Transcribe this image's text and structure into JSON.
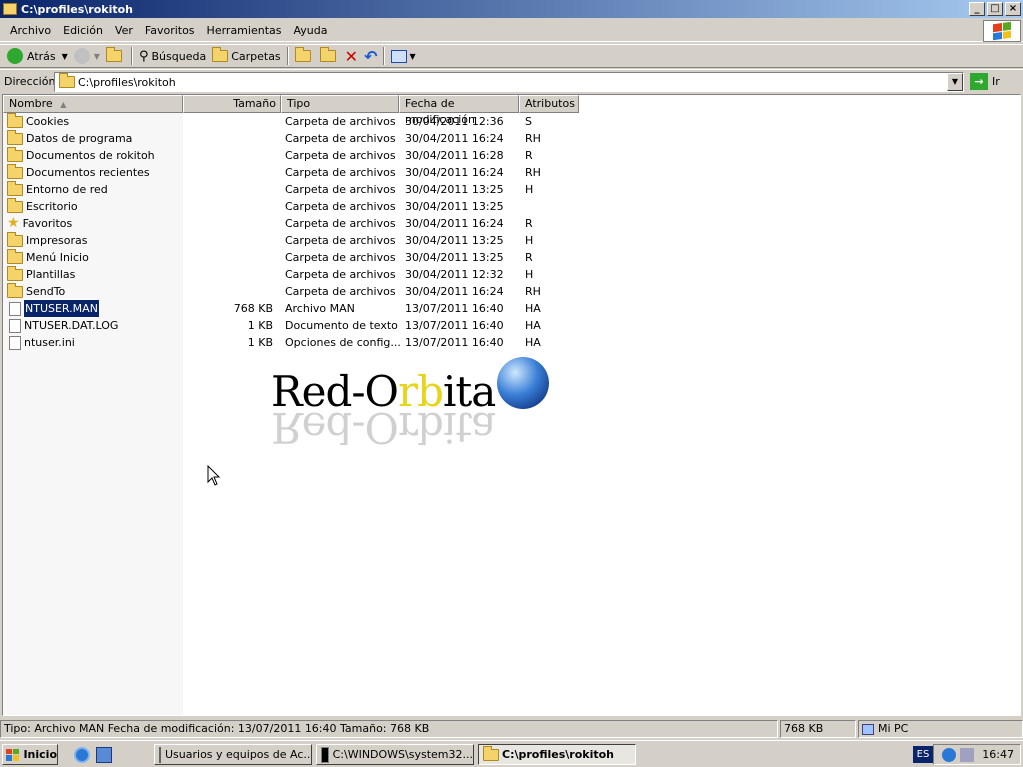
{
  "window": {
    "title": "C:\\profiles\\rokitoh"
  },
  "menu": [
    "Archivo",
    "Edición",
    "Ver",
    "Favoritos",
    "Herramientas",
    "Ayuda"
  ],
  "toolbar": {
    "back": "Atrás",
    "search": "Búsqueda",
    "folders": "Carpetas"
  },
  "address": {
    "label": "Dirección",
    "value": "C:\\profiles\\rokitoh",
    "go": "Ir"
  },
  "columns": {
    "name": "Nombre",
    "size": "Tamaño",
    "type": "Tipo",
    "modified": "Fecha de modificación",
    "attributes": "Atributos"
  },
  "files": [
    {
      "name": "Cookies",
      "size": "",
      "type": "Carpeta de archivos",
      "date": "30/04/2011 12:36",
      "attr": "S",
      "icon": "folder-icon"
    },
    {
      "name": "Datos de programa",
      "size": "",
      "type": "Carpeta de archivos",
      "date": "30/04/2011 16:24",
      "attr": "RH",
      "icon": "folder-icon"
    },
    {
      "name": "Documentos de rokitoh",
      "size": "",
      "type": "Carpeta de archivos",
      "date": "30/04/2011 16:28",
      "attr": "R",
      "icon": "folder-icon"
    },
    {
      "name": "Documentos recientes",
      "size": "",
      "type": "Carpeta de archivos",
      "date": "30/04/2011 16:24",
      "attr": "RH",
      "icon": "recent-folder-icon"
    },
    {
      "name": "Entorno de red",
      "size": "",
      "type": "Carpeta de archivos",
      "date": "30/04/2011 13:25",
      "attr": "H",
      "icon": "folder-icon"
    },
    {
      "name": "Escritorio",
      "size": "",
      "type": "Carpeta de archivos",
      "date": "30/04/2011 13:25",
      "attr": "",
      "icon": "folder-icon"
    },
    {
      "name": "Favoritos",
      "size": "",
      "type": "Carpeta de archivos",
      "date": "30/04/2011 16:24",
      "attr": "R",
      "icon": "star-icon"
    },
    {
      "name": "Impresoras",
      "size": "",
      "type": "Carpeta de archivos",
      "date": "30/04/2011 13:25",
      "attr": "H",
      "icon": "folder-icon"
    },
    {
      "name": "Menú Inicio",
      "size": "",
      "type": "Carpeta de archivos",
      "date": "30/04/2011 13:25",
      "attr": "R",
      "icon": "folder-icon"
    },
    {
      "name": "Plantillas",
      "size": "",
      "type": "Carpeta de archivos",
      "date": "30/04/2011 12:32",
      "attr": "H",
      "icon": "folder-icon"
    },
    {
      "name": "SendTo",
      "size": "",
      "type": "Carpeta de archivos",
      "date": "30/04/2011 16:24",
      "attr": "RH",
      "icon": "folder-icon"
    },
    {
      "name": "NTUSER.MAN",
      "size": "768 KB",
      "type": "Archivo MAN",
      "date": "13/07/2011 16:40",
      "attr": "HA",
      "icon": "file-icon",
      "selected": true
    },
    {
      "name": "NTUSER.DAT.LOG",
      "size": "1 KB",
      "type": "Documento de texto",
      "date": "13/07/2011 16:40",
      "attr": "HA",
      "icon": "text-file-icon"
    },
    {
      "name": "ntuser.ini",
      "size": "1 KB",
      "type": "Opciones de config...",
      "date": "13/07/2011 16:40",
      "attr": "HA",
      "icon": "ini-file-icon"
    }
  ],
  "logo": {
    "text_left": "Red-O",
    "text_r": "r",
    "text_b": "b",
    "text_right": "ita"
  },
  "status": {
    "main": "Tipo: Archivo MAN Fecha de modificación: 13/07/2011 16:40 Tamaño: 768 KB",
    "size": "768 KB",
    "zone": "Mi PC"
  },
  "taskbar": {
    "start": "Inicio",
    "tasks": [
      "Usuarios y equipos de Ac...",
      "C:\\WINDOWS\\system32...",
      "C:\\profiles\\rokitoh"
    ],
    "lang": "ES",
    "clock": "16:47"
  },
  "colors": {
    "title_start": "#0a246a",
    "title_end": "#a6caf0",
    "selection": "#0a246a",
    "folder": "#f4d36a"
  }
}
